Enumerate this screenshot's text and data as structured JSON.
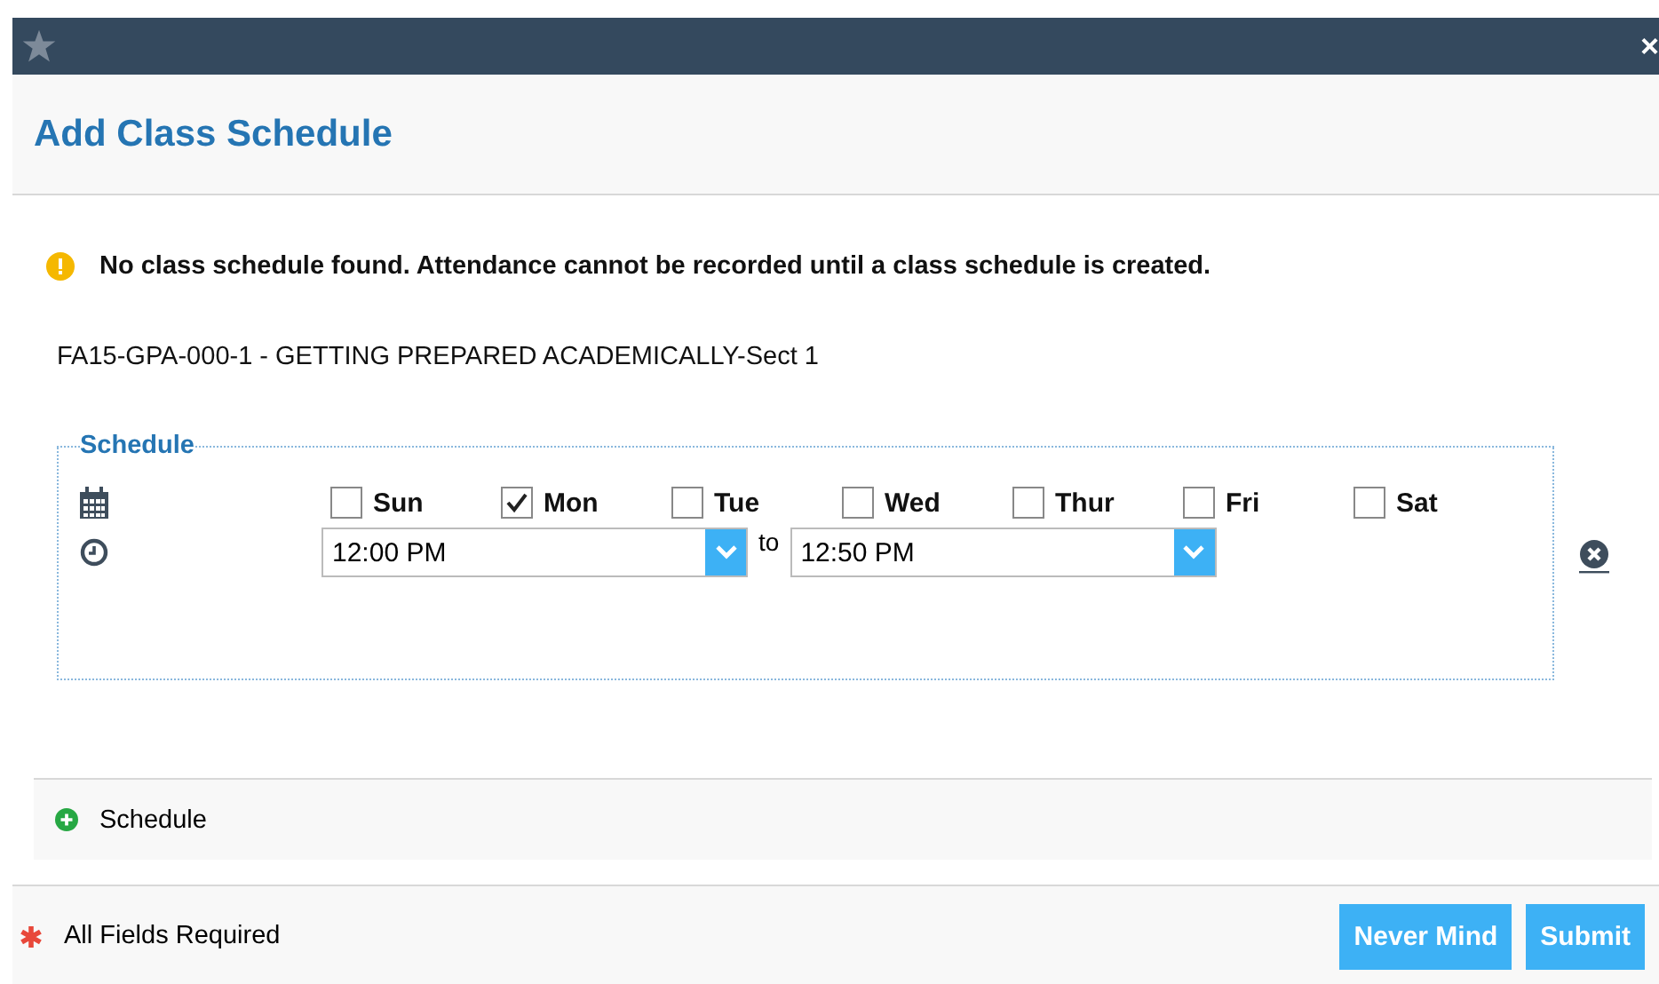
{
  "window": {
    "close": "×"
  },
  "dialog": {
    "title": "Add Class Schedule"
  },
  "warning": {
    "text": "No class schedule found. Attendance cannot be recorded until a class schedule is created."
  },
  "course": "FA15-GPA-000-1 - GETTING PREPARED ACADEMICALLY-Sect 1",
  "schedule": {
    "legend": "Schedule",
    "days": [
      {
        "label": "Sun",
        "checked": false
      },
      {
        "label": "Mon",
        "checked": true
      },
      {
        "label": "Tue",
        "checked": false
      },
      {
        "label": "Wed",
        "checked": false
      },
      {
        "label": "Thur",
        "checked": false
      },
      {
        "label": "Fri",
        "checked": false
      },
      {
        "label": "Sat",
        "checked": false
      }
    ],
    "start_time": "12:00 PM",
    "separator": "to",
    "end_time": "12:50 PM"
  },
  "add_schedule": "Schedule",
  "footer": {
    "required_note": "All Fields Required",
    "buttons": [
      "Never Mind",
      "Submit"
    ]
  }
}
